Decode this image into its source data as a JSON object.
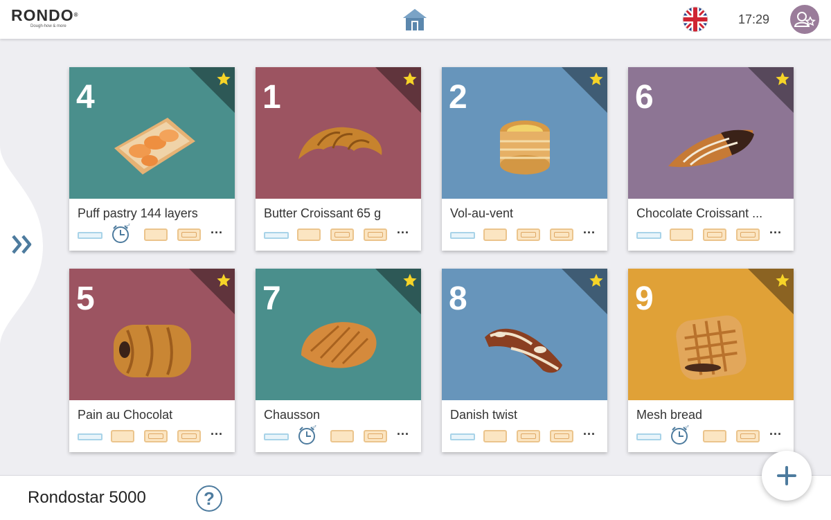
{
  "header": {
    "logo_text": "RONDO",
    "logo_reg": "®",
    "logo_tagline": "Dough-how & more",
    "time": "17:29",
    "home_icon": "home-icon",
    "language_icon": "uk-flag-icon",
    "user_icon": "user-star-icon"
  },
  "side": {
    "toggle_icon": "double-chevron-right-icon",
    "toggle_label": "»"
  },
  "programs": [
    {
      "number": "4",
      "name": "Puff pastry 144 layers",
      "color": "#4a8f8c",
      "favorite": true,
      "pastry": "apricot-tart",
      "steps": [
        "line",
        "clock",
        "sheet",
        "fold",
        "more"
      ]
    },
    {
      "number": "1",
      "name": "Butter Croissant 65 g",
      "color": "#9c5461",
      "favorite": true,
      "pastry": "croissant",
      "steps": [
        "line",
        "sheet",
        "fold",
        "fold",
        "more"
      ]
    },
    {
      "number": "2",
      "name": "Vol-au-vent",
      "color": "#6795bb",
      "favorite": true,
      "pastry": "vol-au-vent",
      "steps": [
        "line",
        "sheet",
        "fold",
        "fold",
        "more"
      ]
    },
    {
      "number": "6",
      "name": "Chocolate Croissant ...",
      "color": "#8d7594",
      "favorite": true,
      "pastry": "chocolate-croissant",
      "steps": [
        "line",
        "sheet",
        "fold",
        "fold",
        "more"
      ]
    },
    {
      "number": "5",
      "name": "Pain au Chocolat",
      "color": "#9c5461",
      "favorite": true,
      "pastry": "pain-au-chocolat",
      "steps": [
        "line",
        "sheet",
        "fold",
        "fold",
        "more"
      ]
    },
    {
      "number": "7",
      "name": "Chausson",
      "color": "#4a8f8c",
      "favorite": true,
      "pastry": "chausson",
      "steps": [
        "line",
        "clock",
        "sheet",
        "fold",
        "more"
      ]
    },
    {
      "number": "8",
      "name": "Danish twist",
      "color": "#6795bb",
      "favorite": true,
      "pastry": "danish-twist",
      "steps": [
        "line",
        "sheet",
        "fold",
        "fold",
        "more"
      ]
    },
    {
      "number": "9",
      "name": "Mesh bread",
      "color": "#e0a137",
      "favorite": true,
      "pastry": "mesh-bread",
      "steps": [
        "line",
        "clock",
        "sheet",
        "fold",
        "more"
      ]
    }
  ],
  "steps_more_label": "...",
  "footer": {
    "machine_name": "Rondostar 5000",
    "help_label": "?",
    "add_label": "+"
  }
}
